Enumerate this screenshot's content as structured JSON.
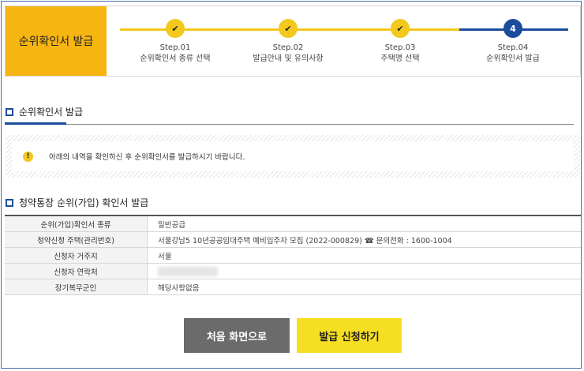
{
  "header": {
    "title": "순위확인서 발급"
  },
  "steps": [
    {
      "number": "Step.01",
      "label": "순위확인서 종류 선택",
      "status": "done",
      "icon": "check"
    },
    {
      "number": "Step.02",
      "label": "발급안내 및 유의사항",
      "status": "done",
      "icon": "check"
    },
    {
      "number": "Step.03",
      "label": "주택명 선택",
      "status": "done",
      "icon": "check"
    },
    {
      "number": "Step.04",
      "label": "순위확인서 발급",
      "status": "active",
      "icon": "4"
    }
  ],
  "section1": {
    "title": "순위확인서 발급"
  },
  "notice": {
    "icon": "!",
    "text": "아래의 내역을 확인하신 후 순위확인서를 발급하시기 바랍니다."
  },
  "section2": {
    "title": "청약통장 순위(가입) 확인서 발급"
  },
  "table": {
    "rows": [
      {
        "label": "순위(가입)확인서 종류",
        "value": "일반공급"
      },
      {
        "label": "청약신청 주택(관리번호)",
        "value": "서울강남5 10년공공임대주택 예비입주자 모집 (2022-000829) ☎ 문의전화 : 1600-1004"
      },
      {
        "label": "신청자 거주지",
        "value": "서울"
      },
      {
        "label": "신청자 연락처",
        "value": ""
      },
      {
        "label": "장기복무군인",
        "value": "해당사항없음"
      }
    ]
  },
  "buttons": {
    "back": "처음 화면으로",
    "apply": "발급 신청하기"
  },
  "colors": {
    "accent_yellow": "#f6b511",
    "step_yellow": "#f2c91c",
    "navy": "#1c4c9c",
    "button_gray": "#6b6b6b",
    "button_yellow": "#f6de23"
  }
}
